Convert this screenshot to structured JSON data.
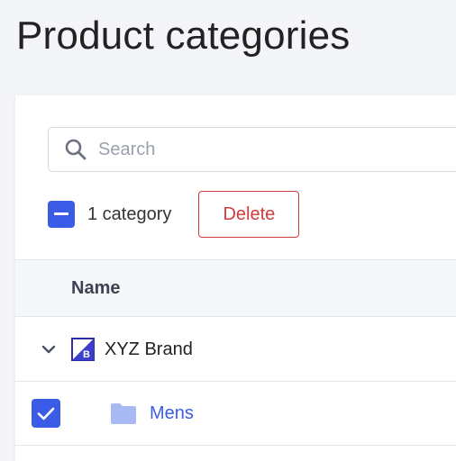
{
  "page": {
    "title": "Product categories"
  },
  "search": {
    "placeholder": "Search",
    "value": "",
    "icon": "search-icon"
  },
  "bulk_actions": {
    "selection_state": "indeterminate",
    "count_label": "1 category",
    "delete_label": "Delete"
  },
  "table": {
    "columns": [
      "Name"
    ],
    "rows": [
      {
        "name": "XYZ Brand",
        "type": "brand",
        "expanded": true,
        "icon": "brand-logo-icon",
        "selected": false
      },
      {
        "name": "Mens",
        "type": "category",
        "icon": "folder-icon",
        "selected": true,
        "parent": "XYZ Brand"
      }
    ]
  },
  "colors": {
    "accent": "#3b5ce6",
    "danger": "#d03b3b",
    "folder": "#a9b9f4",
    "background": "#f4f5f9"
  }
}
